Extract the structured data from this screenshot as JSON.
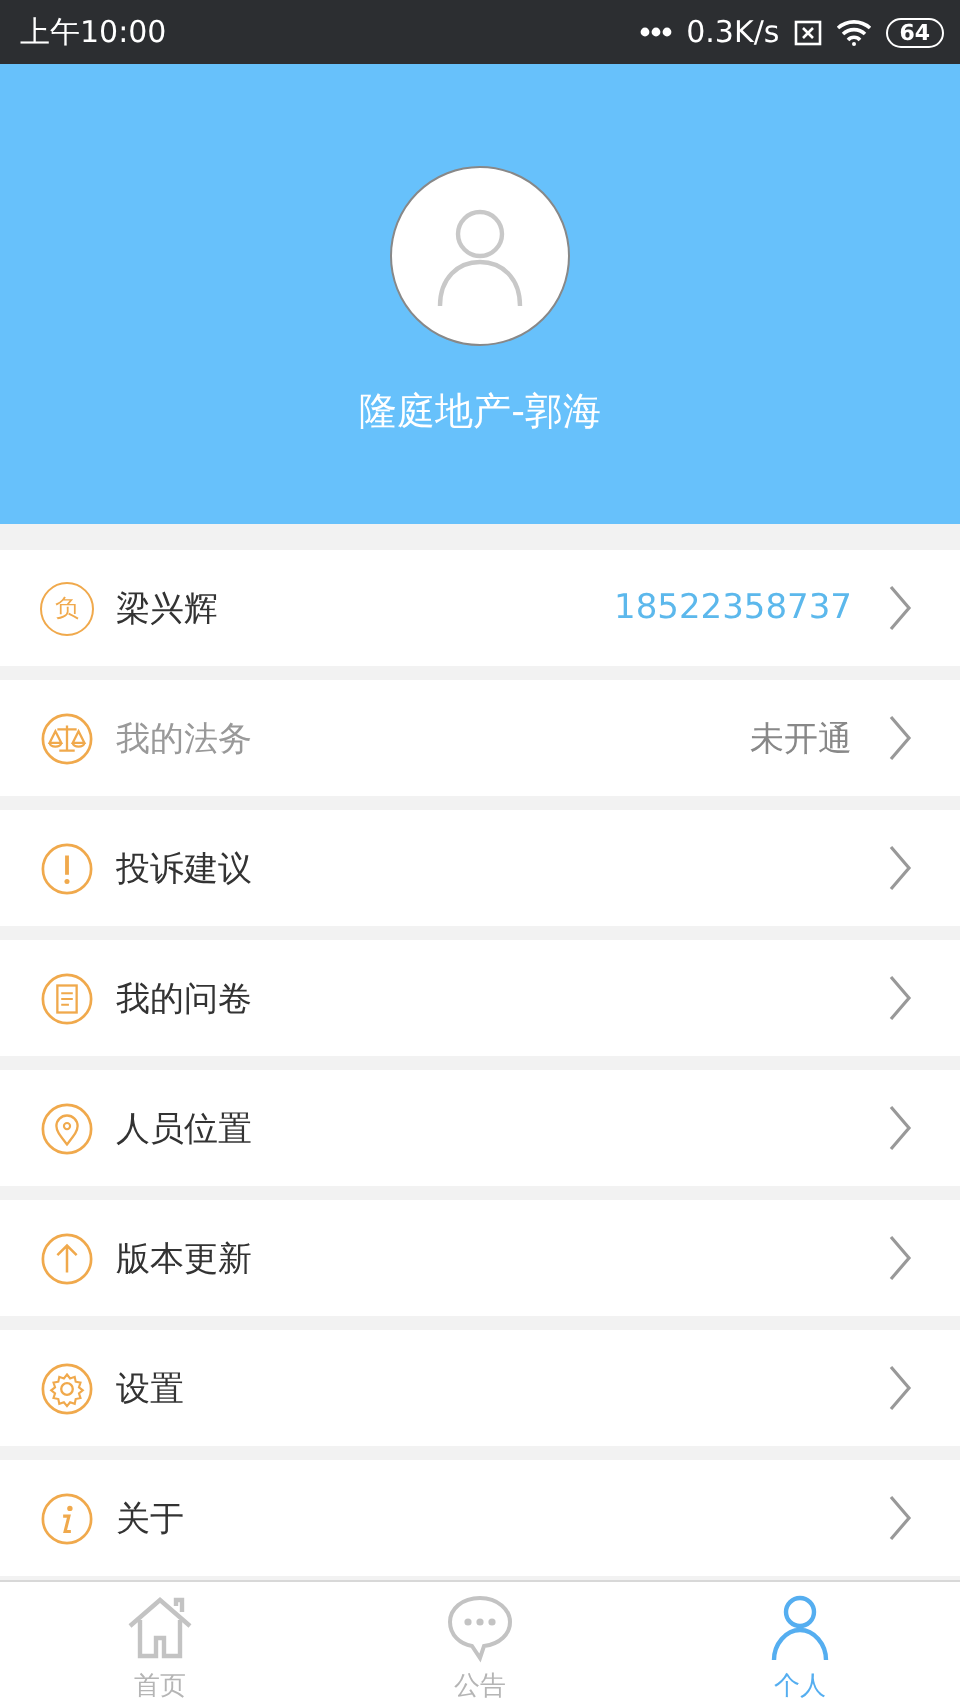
{
  "status_bar": {
    "time": "上午10:00",
    "speed": "0.3K/s",
    "battery": "64"
  },
  "profile": {
    "name": "隆庭地产-郭海"
  },
  "menu": [
    {
      "kind": "badge",
      "badge": "负",
      "label": "梁兴辉",
      "value": "18522358737",
      "disabled": false
    },
    {
      "kind": "scale",
      "label": "我的法务",
      "value": "未开通",
      "disabled": true
    },
    {
      "kind": "alert",
      "label": "投诉建议",
      "disabled": false
    },
    {
      "kind": "document",
      "label": "我的问卷",
      "disabled": false
    },
    {
      "kind": "location",
      "label": "人员位置",
      "disabled": false
    },
    {
      "kind": "upload",
      "label": "版本更新",
      "disabled": false
    },
    {
      "kind": "gear",
      "label": "设置",
      "disabled": false
    },
    {
      "kind": "info",
      "label": "关于",
      "disabled": false
    }
  ],
  "tabs": [
    {
      "kind": "home",
      "label": "首页",
      "selected": false
    },
    {
      "kind": "chat",
      "label": "公告",
      "selected": false
    },
    {
      "kind": "person",
      "label": "个人",
      "selected": true
    }
  ]
}
